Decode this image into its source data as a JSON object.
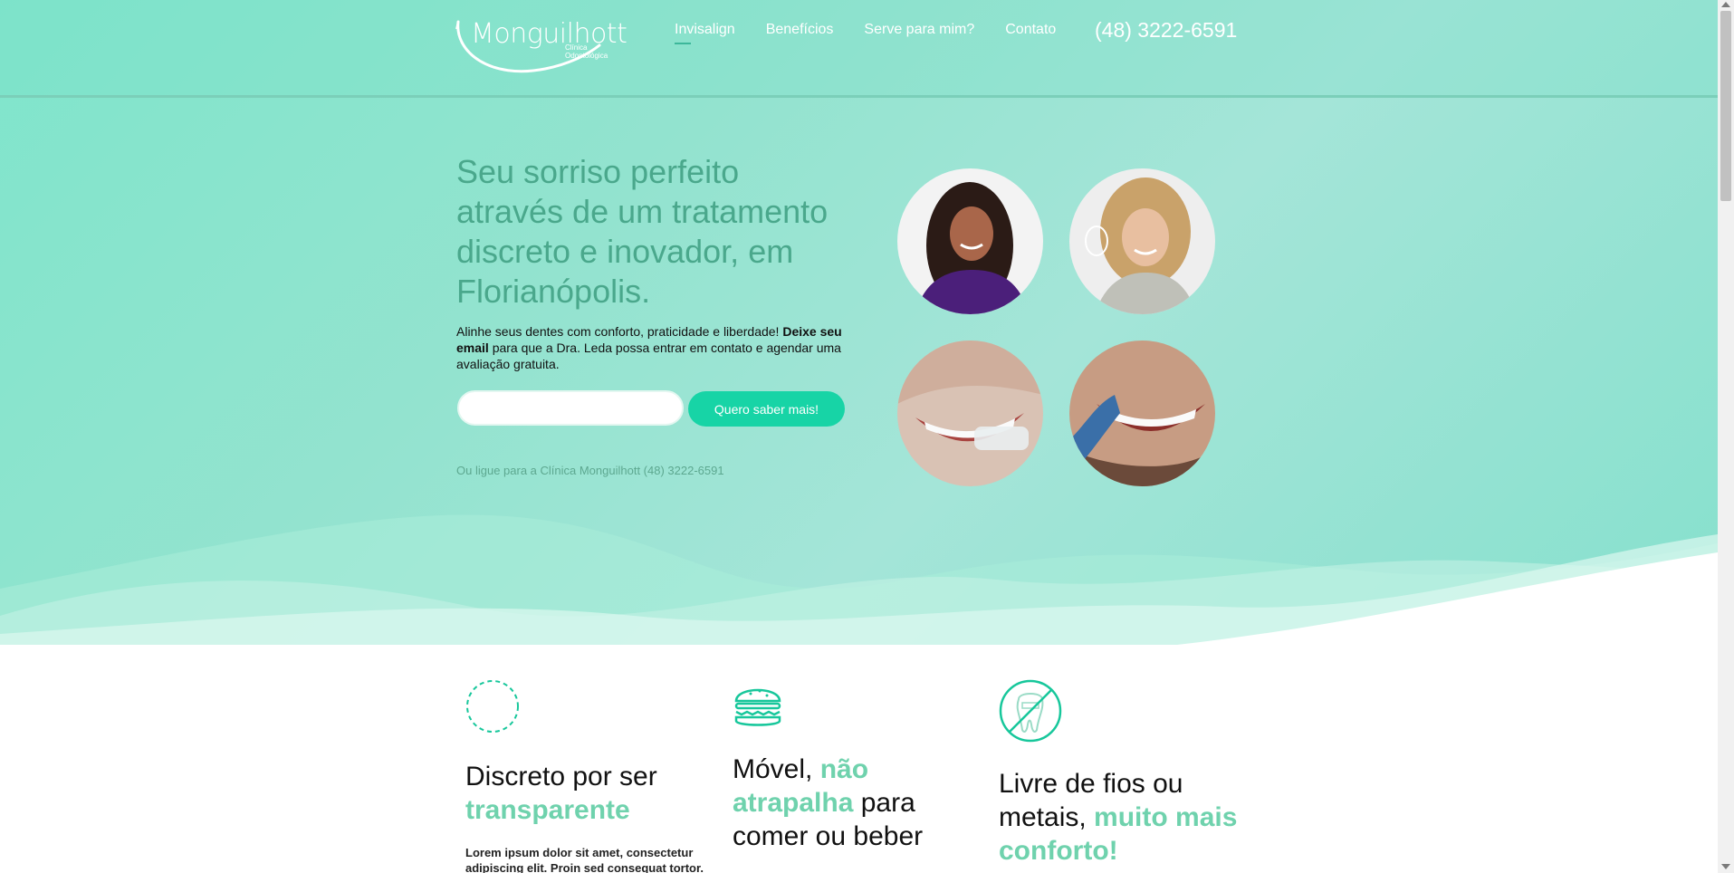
{
  "header": {
    "logo_name": "Monguilhott",
    "logo_subtitle": "Clínica Odontológica",
    "nav": [
      {
        "label": "Invisalign"
      },
      {
        "label": "Benefícios"
      },
      {
        "label": "Serve para mim?"
      },
      {
        "label": "Contato"
      }
    ],
    "phone": "(48) 3222-6591"
  },
  "hero": {
    "title": "Seu sorriso perfeito através de um tratamento discreto e inovador, em Florianópolis.",
    "desc_part1": "Alinhe seus dentes com conforto, praticidade e liberdade! ",
    "desc_bold": "Deixe seu email",
    "desc_part2": " para que a Dra. Leda possa entrar em contato e agendar uma avaliação gratuita.",
    "email_placeholder": "",
    "cta_label": "Quero saber mais!",
    "call_note": "Ou ligue para a Clínica Monguilhott (48) 3222-6591"
  },
  "features": [
    {
      "title_pre": "Discreto por ser ",
      "title_hl": "transparente",
      "title_post": "",
      "text": "Lorem ipsum dolor sit amet, consectetur adipiscing elit. Proin sed consequat tortor."
    },
    {
      "title_pre": "Móvel, ",
      "title_hl": "não atrapalha",
      "title_post": " para comer ou beber",
      "text": ""
    },
    {
      "title_pre": "Livre de fios ou metais, ",
      "title_hl": "muito mais conforto!",
      "title_post": "",
      "text": ""
    }
  ],
  "icons": {
    "feature1": "dashed-circle-icon",
    "feature2": "burger-icon",
    "feature3": "no-braces-icon"
  },
  "colors": {
    "accent": "#17d4a6",
    "title_green": "#4aa88c",
    "highlight": "#6fd2ad",
    "hero_bg": "#93e3cf"
  }
}
